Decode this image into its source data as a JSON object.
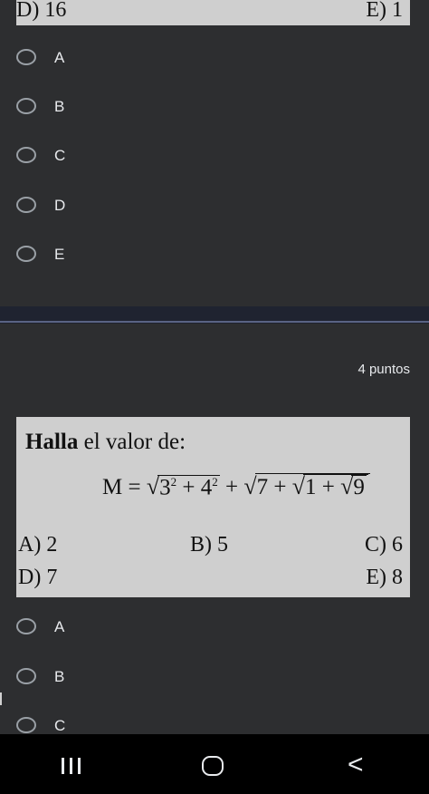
{
  "question1": {
    "image_options": [
      {
        "label": "D) 16"
      },
      {
        "label": "E) 1"
      }
    ],
    "choices": [
      "A",
      "B",
      "C",
      "D",
      "E"
    ]
  },
  "question2": {
    "points": "4 puntos",
    "heading_bold": "Halla",
    "heading_rest": " el valor de:",
    "formula": {
      "lhs": "M",
      "eq": "=",
      "sqrt1_a": "3",
      "sqrt1_a_exp": "2",
      "plus1": "+",
      "sqrt1_b": "4",
      "sqrt1_b_exp": "2",
      "plus_mid": "+",
      "seven": "7",
      "plus2": "+",
      "one": "1",
      "plus3": "+",
      "nine": "9",
      "radical": "√"
    },
    "image_options": {
      "a": "A) 2",
      "b": "B) 5",
      "c": "C) 6",
      "d": "D) 7",
      "e": "E) 8"
    },
    "choices": [
      "A",
      "B",
      "C"
    ]
  },
  "navbar": {
    "back_glyph": "<"
  }
}
